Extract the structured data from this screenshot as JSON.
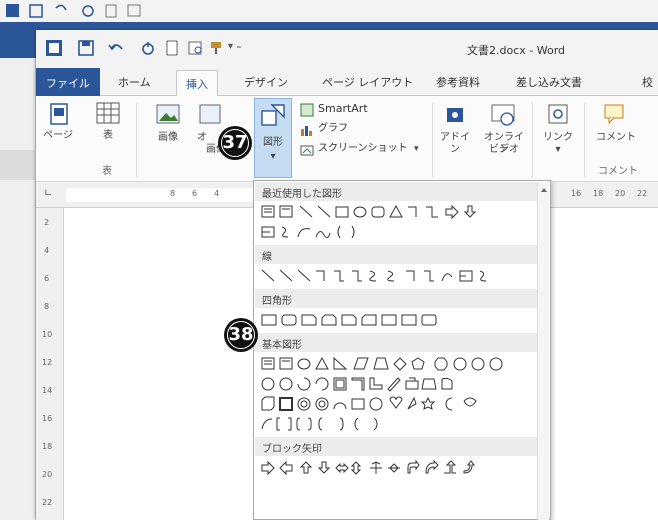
{
  "window": {
    "title": "文書2.docx - Word"
  },
  "tabs": [
    "ファイル",
    "ホーム",
    "挿入",
    "デザイン",
    "ページ レイアウト",
    "参考資料",
    "差し込み文書",
    "校"
  ],
  "active_tab": "挿入",
  "ribbon": {
    "page_label": "ページ",
    "table_label": "表",
    "table_group": "表",
    "picture_label": "画像",
    "online_picture_label": "オ",
    "online_picture_label2": "画像",
    "shapes_label": "図形",
    "smartart_label": "SmartArt",
    "chart_label": "グラフ",
    "screenshot_label": "スクリーンショット",
    "apps_label": "アドイ",
    "apps_label2": "ン",
    "video_label": "オンライン",
    "video_label2": "ビデオ",
    "link_label": "リンク",
    "comment_label": "コメント",
    "comment_group": "コメント"
  },
  "shapes_menu": {
    "sections": [
      "最近使用した図形",
      "線",
      "四角形",
      "基本図形",
      "ブロック矢印"
    ]
  },
  "badges": [
    "37",
    "38"
  ],
  "ruler_numbers": [
    "8",
    "6",
    "4",
    "16",
    "18",
    "20",
    "22"
  ],
  "vruler_numbers": [
    "2",
    "4",
    "6",
    "8",
    "10",
    "12",
    "14",
    "16",
    "18",
    "20",
    "22"
  ],
  "colors": {
    "accent": "#2b579a",
    "badge": "#111111"
  }
}
